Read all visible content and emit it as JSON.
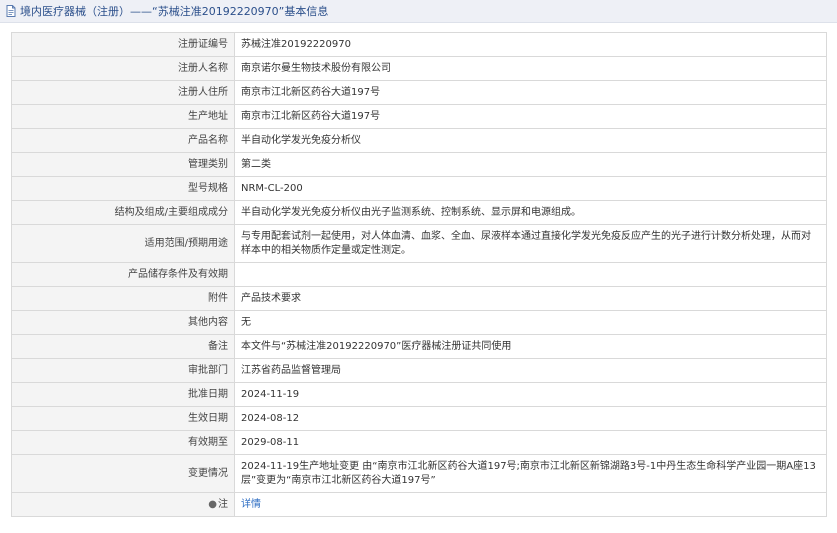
{
  "header": {
    "title": "境内医疗器械（注册）——“苏械注准20192220970”基本信息"
  },
  "rows": [
    {
      "label": "注册证编号",
      "value": "苏械注准20192220970"
    },
    {
      "label": "注册人名称",
      "value": "南京诺尔曼生物技术股份有限公司"
    },
    {
      "label": "注册人住所",
      "value": "南京市江北新区药谷大道197号"
    },
    {
      "label": "生产地址",
      "value": "南京市江北新区药谷大道197号"
    },
    {
      "label": "产品名称",
      "value": "半自动化学发光免疫分析仪"
    },
    {
      "label": "管理类别",
      "value": "第二类"
    },
    {
      "label": "型号规格",
      "value": "NRM-CL-200"
    },
    {
      "label": "结构及组成/主要组成成分",
      "value": "半自动化学发光免疫分析仪由光子监测系统、控制系统、显示屏和电源组成。"
    },
    {
      "label": "适用范围/预期用途",
      "value": "与专用配套试剂一起使用，对人体血清、血浆、全血、尿液样本通过直接化学发光免疫反应产生的光子进行计数分析处理，从而对样本中的相关物质作定量或定性测定。"
    },
    {
      "label": "产品储存条件及有效期",
      "value": ""
    },
    {
      "label": "附件",
      "value": "产品技术要求"
    },
    {
      "label": "其他内容",
      "value": "无"
    },
    {
      "label": "备注",
      "value": "本文件与“苏械注准20192220970”医疗器械注册证共同使用"
    },
    {
      "label": "审批部门",
      "value": "江苏省药品监督管理局"
    },
    {
      "label": "批准日期",
      "value": "2024-11-19"
    },
    {
      "label": "生效日期",
      "value": "2024-08-12"
    },
    {
      "label": "有效期至",
      "value": "2029-08-11"
    },
    {
      "label": "变更情况",
      "value": "2024-11-19生产地址变更 由“南京市江北新区药谷大道197号;南京市江北新区新锦湖路3号-1中丹生态生命科学产业园一期A座13层”变更为“南京市江北新区药谷大道197号”"
    }
  ],
  "note": {
    "label": "注",
    "icon": "note-icon",
    "link_text": "详情"
  }
}
